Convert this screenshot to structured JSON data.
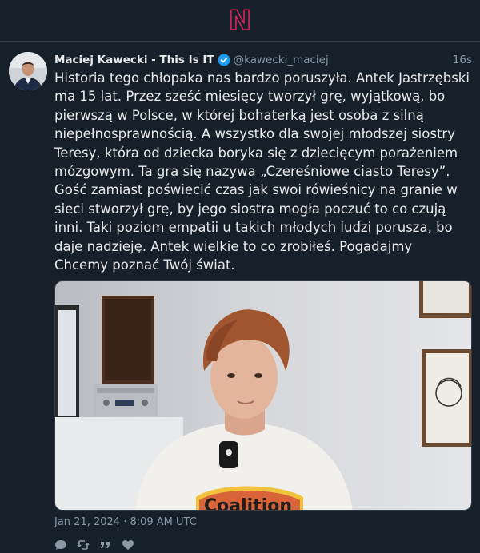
{
  "app": {
    "logo_letter": "N",
    "logo_color": "#e0245e"
  },
  "post": {
    "author_name": "Maciej Kawecki - This Is IT",
    "verified": true,
    "handle": "@kawecki_maciej",
    "relative_time": "16s",
    "text": "Historia tego chłopaka nas bardzo poruszyła. Antek Jastrzębski ma 15 lat. Przez sześć miesięcy tworzył grę, wyjątkową, bo pierwszą w Polsce, w której bohaterką jest osoba z silną niepełnosprawnością. A wszystko dla swojej młodszej siostry Teresy, która od dziecka boryka się z dziecięcym porażeniem mózgowym. Ta gra się nazywa „Czereśniowe ciasto Teresy”. Gość zamiast poświecić czas jak swoi rówieśnicy na granie w sieci stworzył grę, by jego siostra mogła poczuć to co czują inni. Taki poziom empatii u takich młodych ludzi porusza, bo daje nadzieję. Antek wielkie to co zrobiłeś. Pogadajmy    Chcemy poznać Twój świat.",
    "media_shirt_text": "Coalition",
    "date": "Jan 21, 2024 · 8:09 AM UTC"
  },
  "actions": [
    {
      "icon": "reply-icon"
    },
    {
      "icon": "retweet-icon"
    },
    {
      "icon": "quote-icon"
    },
    {
      "icon": "like-icon"
    }
  ],
  "colors": {
    "background": "#15202b",
    "text": "#e7e9ea",
    "muted": "#8b98a5",
    "verified": "#1d9bf0"
  }
}
